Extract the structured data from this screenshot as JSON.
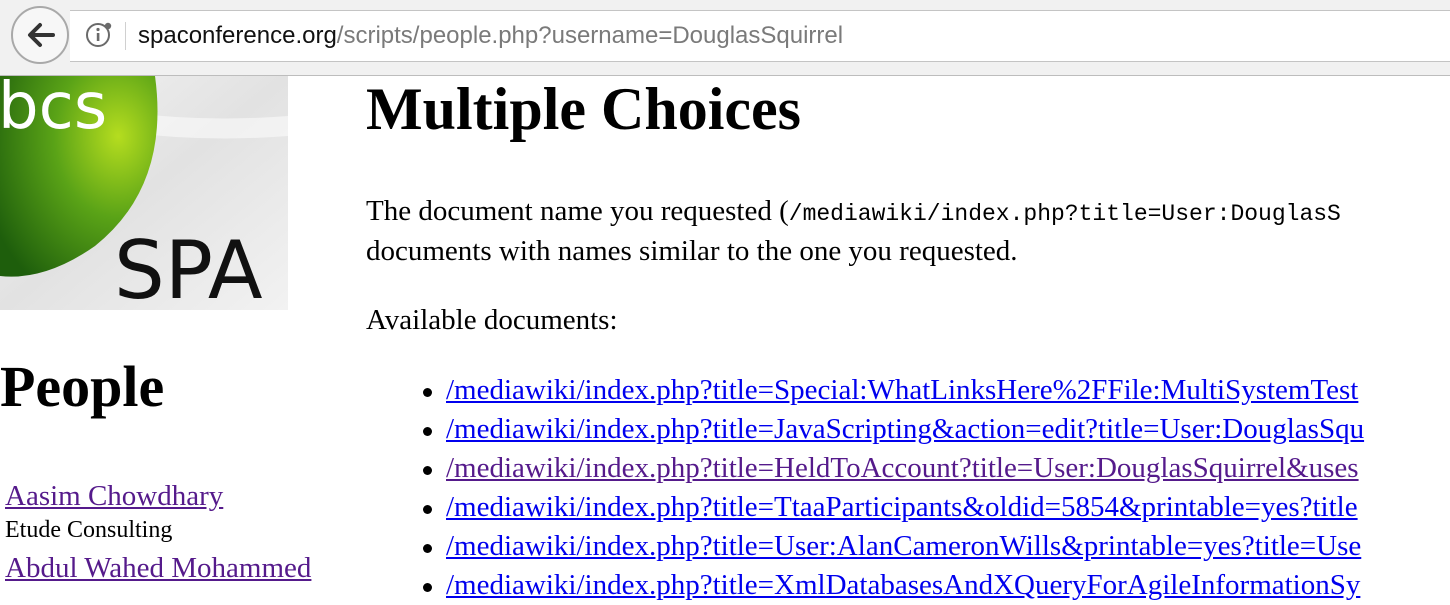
{
  "browser": {
    "url_host": "spaconference.org",
    "url_path": "/scripts/people.php?username=DouglasSquirrel",
    "back_icon": "back-arrow-icon",
    "info_icon": "info-icon"
  },
  "logo": {
    "text_top": "bcs",
    "text_bottom": "SPA",
    "colors": {
      "green_dark": "#1f6b0f",
      "green_light": "#9ad11a",
      "gray": "#e6e6e6"
    }
  },
  "sidebar": {
    "title": "People",
    "people": [
      {
        "name": "Aasim Chowdhary",
        "org": "Etude Consulting"
      },
      {
        "name": "Abdul Wahed Mohammed",
        "org": ""
      }
    ]
  },
  "main": {
    "title": "Multiple Choices",
    "para_before": "The document name you requested (",
    "para_code": "/mediawiki/index.php?title=User:DouglasS",
    "para_line2": "documents with names similar to the one you requested.",
    "available_label": "Available documents:",
    "documents": [
      {
        "text": "/mediawiki/index.php?title=Special:WhatLinksHere%2FFile:MultiSystemTest",
        "visited": false
      },
      {
        "text": "/mediawiki/index.php?title=JavaScripting&action=edit?title=User:DouglasSqu",
        "visited": false
      },
      {
        "text": "/mediawiki/index.php?title=HeldToAccount?title=User:DouglasSquirrel&uses",
        "visited": true
      },
      {
        "text": "/mediawiki/index.php?title=TtaaParticipants&oldid=5854&printable=yes?title",
        "visited": false
      },
      {
        "text": "/mediawiki/index.php?title=User:AlanCameronWills&printable=yes?title=Use",
        "visited": false
      },
      {
        "text": "/mediawiki/index.php?title=XmlDatabasesAndXQueryForAgileInformationSy",
        "visited": false
      }
    ]
  }
}
